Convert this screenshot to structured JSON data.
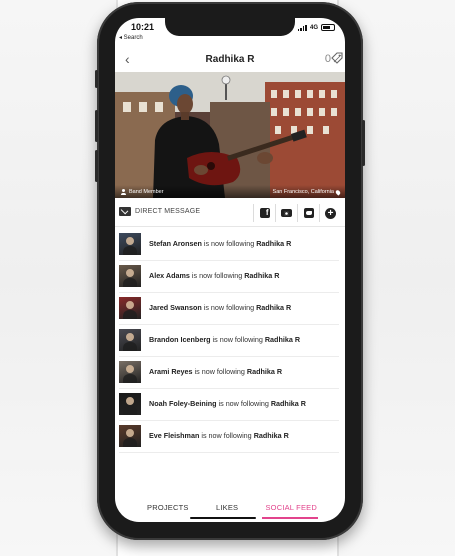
{
  "status_bar": {
    "time": "10:21",
    "back_app": "◂ Search",
    "network": "4G"
  },
  "nav": {
    "back_glyph": "‹",
    "title": "Radhika R",
    "count": "0",
    "tag_icon": "tag-icon"
  },
  "hero": {
    "role": "Band Member",
    "location": "San Francisco, California"
  },
  "actions": {
    "direct_message": "DIRECT MESSAGE",
    "facebook_glyph": "f",
    "plus_glyph": "+"
  },
  "feed": {
    "verb": "is now following",
    "items": [
      {
        "name": "Stefan Aronsen",
        "target": "Radhika R",
        "avatar": "#3d4a5e"
      },
      {
        "name": "Alex Adams",
        "target": "Radhika R",
        "avatar": "#6a5a4a"
      },
      {
        "name": "Jared Swanson",
        "target": "Radhika R",
        "avatar": "#8a2a2a"
      },
      {
        "name": "Brandon Icenberg",
        "target": "Radhika R",
        "avatar": "#4a4a52"
      },
      {
        "name": "Arami Reyes",
        "target": "Radhika R",
        "avatar": "#7a7066"
      },
      {
        "name": "Noah Foley-Beining",
        "target": "Radhika R",
        "avatar": "#1a1a1a"
      },
      {
        "name": "Eve Fleishman",
        "target": "Radhika R",
        "avatar": "#5a3a2a"
      }
    ]
  },
  "tabs": {
    "projects": "PROJECTS",
    "likes": "LIKES",
    "social_feed": "SOCIAL FEED",
    "active_color": "#e2448c"
  }
}
